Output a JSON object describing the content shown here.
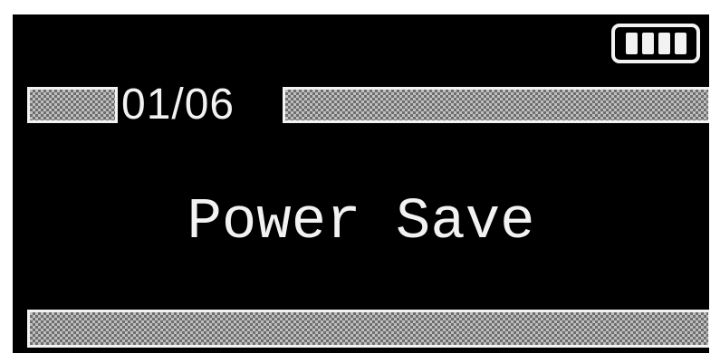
{
  "battery": {
    "icon": "battery-icon",
    "level": 1.0,
    "cells": 4
  },
  "header": {
    "page_counter": "01/06"
  },
  "main": {
    "mode_label": "Power Save"
  },
  "colors": {
    "screen_background": "#000000",
    "foreground": "#f2f2f2"
  }
}
